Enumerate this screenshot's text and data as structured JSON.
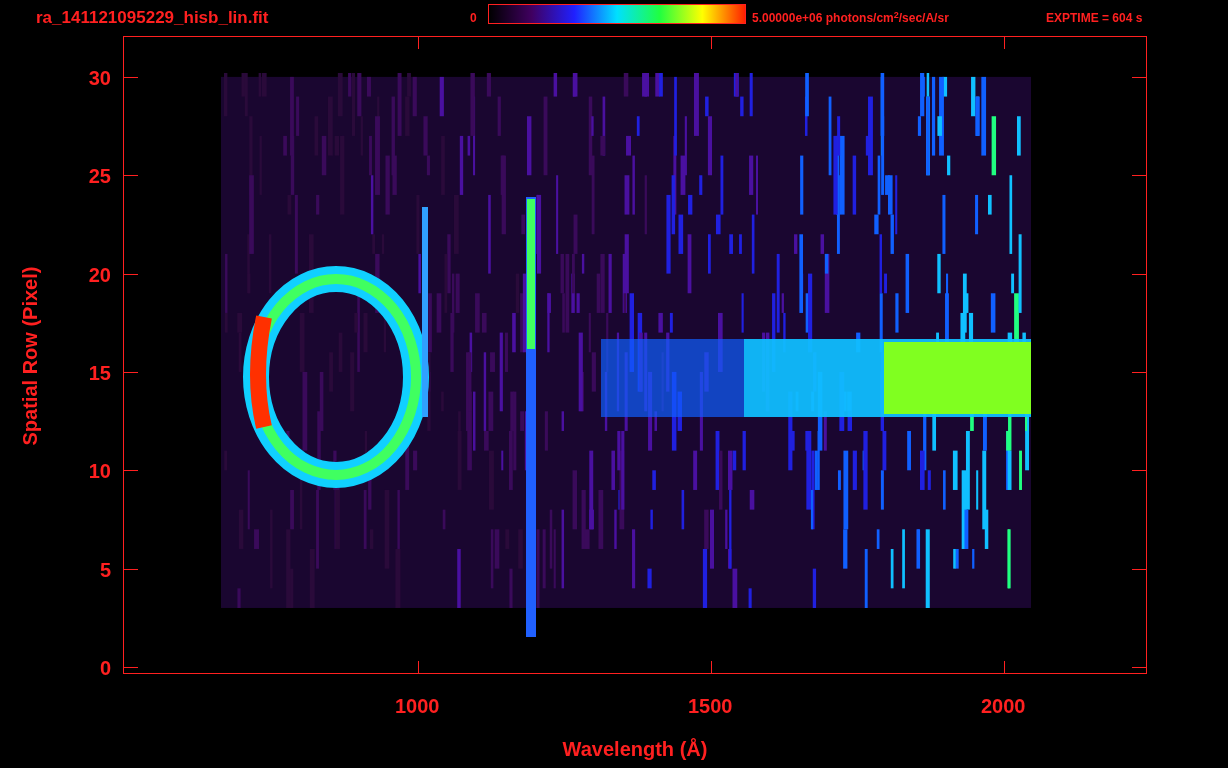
{
  "title": "ra_141121095229_hisb_lin.fit",
  "colorbar": {
    "min_label": "0",
    "max_label": "5.00000e+06 photons/cm$^{2}$/sec/A/sr"
  },
  "exposure": "EXPTIME = 604 s",
  "y_axis": {
    "label": "Spatial Row (Pixel)",
    "ticks": [
      "30",
      "25",
      "20",
      "15",
      "10",
      "5",
      "0"
    ]
  },
  "x_axis": {
    "label": "Wavelength (Å)",
    "ticks": [
      "1000",
      "1500",
      "2000"
    ]
  }
}
